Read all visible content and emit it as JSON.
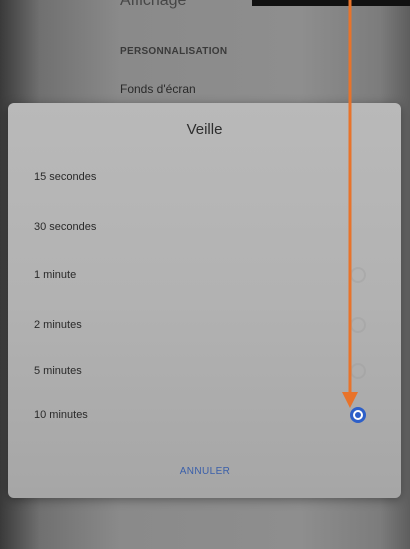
{
  "background": {
    "header": "Affichage",
    "section": "PERSONNALISATION",
    "wallpaper": "Fonds d'écran"
  },
  "dialog": {
    "title": "Veille",
    "options": [
      {
        "label": "15 secondes",
        "selected": false
      },
      {
        "label": "30 secondes",
        "selected": false
      },
      {
        "label": "1 minute",
        "selected": false
      },
      {
        "label": "2 minutes",
        "selected": false
      },
      {
        "label": "5 minutes",
        "selected": false
      },
      {
        "label": "10 minutes",
        "selected": true
      }
    ],
    "cancel_label": "ANNULER"
  },
  "colors": {
    "accent": "#2d5fc8",
    "annotation_arrow": "#e8732a"
  },
  "icons": {
    "selected_radio": "radio-selected-icon",
    "arrow": "arrow-down-icon"
  }
}
